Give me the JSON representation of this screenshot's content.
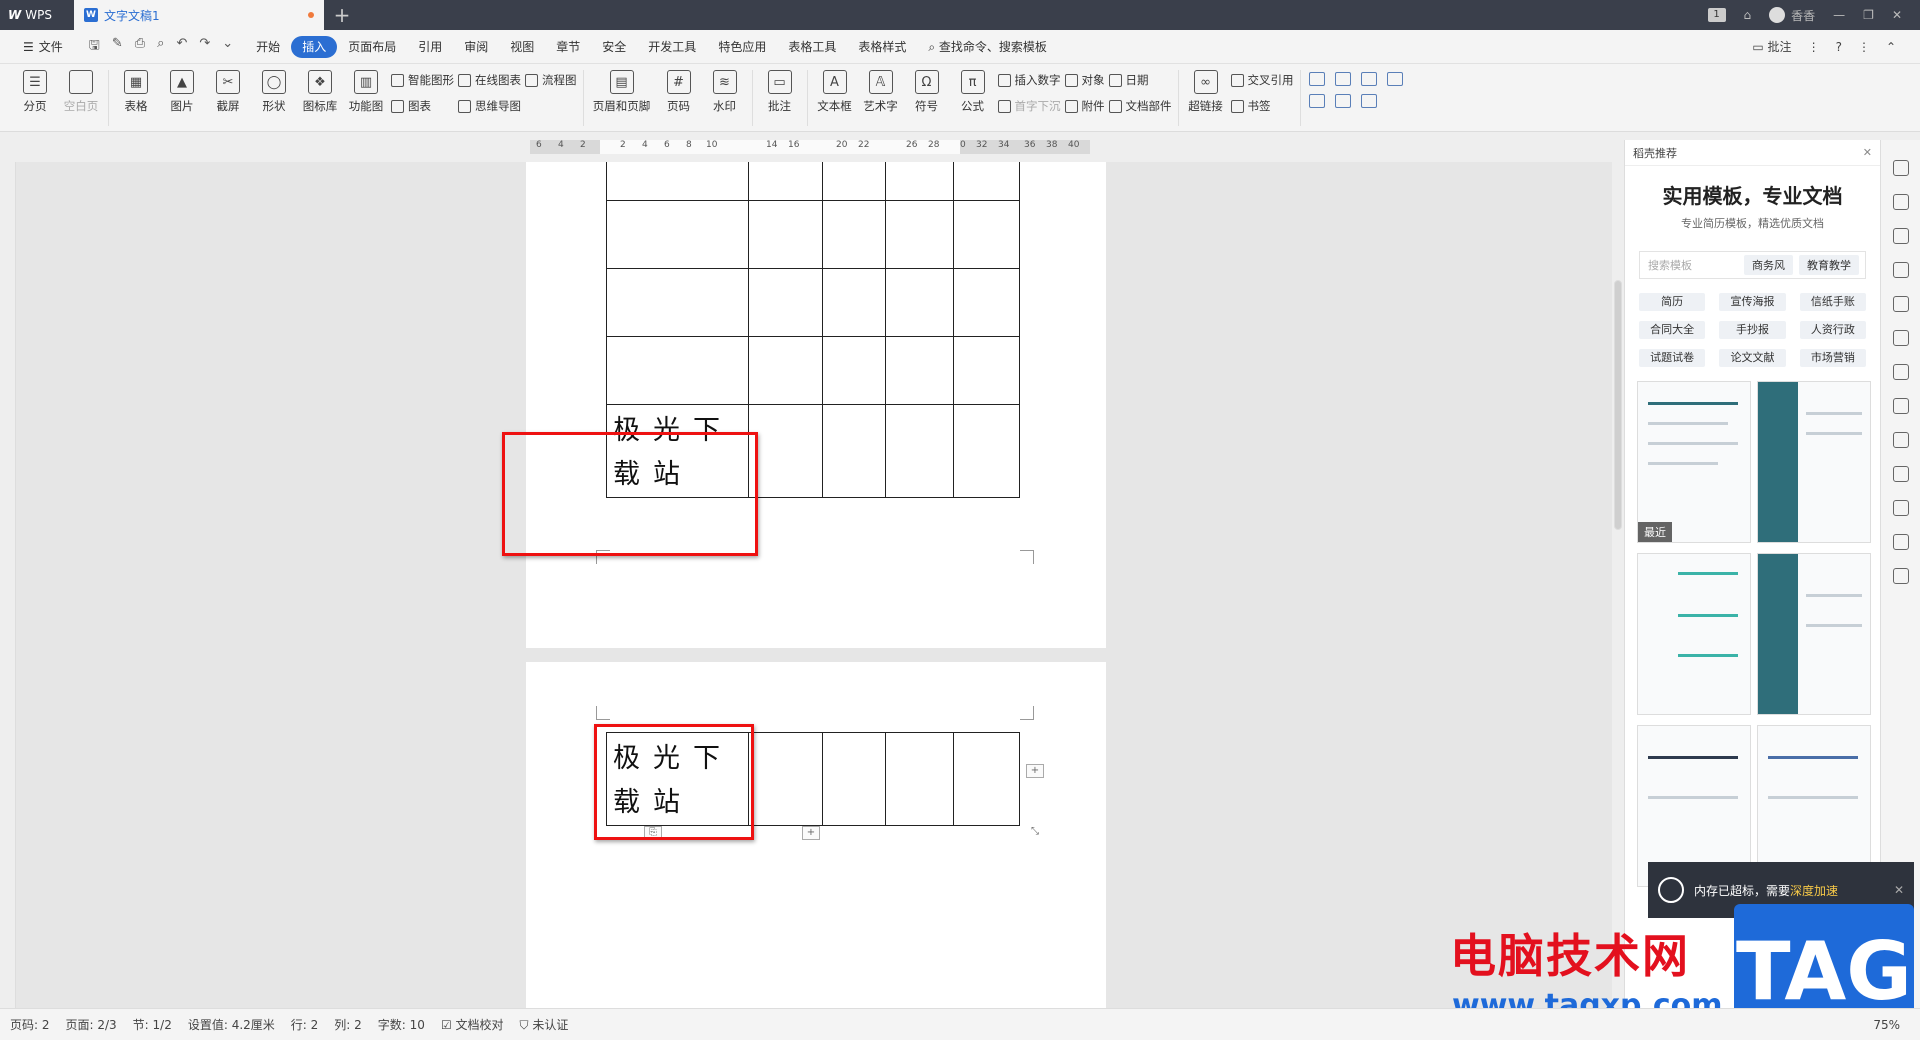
{
  "titlebar": {
    "app": "WPS",
    "tab_title": "文字文稿1",
    "badge": "1",
    "user": "香香"
  },
  "menubar": {
    "file": "文件",
    "items": [
      "开始",
      "插入",
      "页面布局",
      "引用",
      "审阅",
      "视图",
      "章节",
      "安全",
      "开发工具",
      "特色应用",
      "表格工具",
      "表格样式"
    ],
    "active": "插入",
    "search": "查找命令、搜索模板",
    "comment": "批注"
  },
  "ribbon": {
    "page_break": "分页",
    "blank_page": "空白页",
    "table": "表格",
    "picture": "图片",
    "screenshot": "截屏",
    "shape": "形状",
    "icon_lib": "图标库",
    "function_chart": "功能图",
    "smart_shape": "智能图形",
    "online_chart": "在线图表",
    "flowchart": "流程图",
    "chart": "图表",
    "mindmap": "思维导图",
    "header_footer": "页眉和页脚",
    "page_number": "页码",
    "watermark": "水印",
    "comment": "批注",
    "textbox": "文本框",
    "wordart": "艺术字",
    "symbol": "符号",
    "formula": "公式",
    "insert_number": "插入数字",
    "dropcap": "首字下沉",
    "object": "对象",
    "attachment": "附件",
    "date": "日期",
    "doc_parts": "文档部件",
    "hyperlink": "超链接",
    "cross_ref": "交叉引用",
    "bookmark": "书签"
  },
  "ruler": {
    "ticks": [
      "6",
      "4",
      "2",
      "2",
      "4",
      "6",
      "8",
      "10",
      "14",
      "16",
      "20",
      "22",
      "26",
      "28",
      "0",
      "32",
      "34",
      "36",
      "38",
      "40"
    ]
  },
  "document": {
    "cell_text": "极光下载站"
  },
  "sidepanel": {
    "header": "稻壳推荐",
    "title": "实用模板，专业文档",
    "subtitle": "专业简历模板，精选优质文档",
    "search_placeholder": "搜索模板",
    "chips": [
      "商务风",
      "教育教学"
    ],
    "tags": [
      "简历",
      "宣传海报",
      "信纸手账",
      "合同大全",
      "手抄报",
      "人资行政",
      "试题试卷",
      "论文文献",
      "市场营销"
    ],
    "recent_label": "最近"
  },
  "notification": {
    "text": "内存已超标，需要",
    "accent": "深度加速"
  },
  "watermark": {
    "site": "电脑技术网",
    "url": "www.tagxp.com",
    "tag": "TAG"
  },
  "statusbar": {
    "page_num": "页码: 2",
    "pages": "页面: 2/3",
    "section": "节: 1/2",
    "setting": "设置值: 4.2厘米",
    "row": "行: 2",
    "col": "列: 2",
    "words": "字数: 10",
    "proof": "文档校对",
    "cert": "未认证",
    "zoom": "75%"
  }
}
